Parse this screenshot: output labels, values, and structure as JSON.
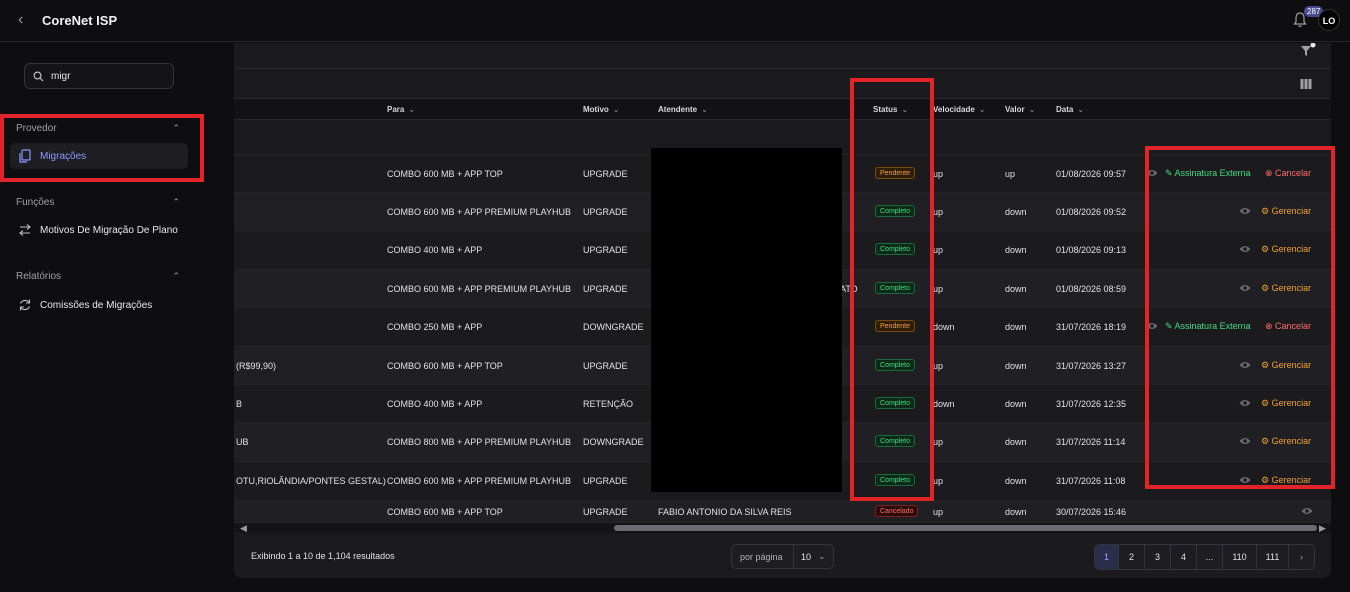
{
  "header": {
    "title": "CoreNet ISP",
    "notifications": "287",
    "user_initials": "LO"
  },
  "sidebar": {
    "search": {
      "value": "migr",
      "placeholder": ""
    },
    "sections": [
      {
        "label": "Provedor",
        "items": [
          {
            "label": "Migrações",
            "active": true,
            "icon": "copy-icon"
          }
        ]
      },
      {
        "label": "Funções",
        "items": [
          {
            "label": "Motivos De Migração De Plano",
            "icon": "arrows-swap-icon"
          }
        ]
      },
      {
        "label": "Relatórios",
        "items": [
          {
            "label": "Comissões de Migrações",
            "icon": "refresh-icon"
          }
        ]
      }
    ]
  },
  "table": {
    "columns": [
      "Para",
      "Motivo",
      "Atendente",
      "Status",
      "Velocidade",
      "Valor",
      "Data"
    ],
    "rows": [
      {
        "de": "",
        "para": "COMBO 600 MB + APP TOP",
        "motivo": "UPGRADE",
        "atendente": "",
        "status": "Pendente",
        "velocidade": "up",
        "valor": "up",
        "data": "01/08/2026 09:57",
        "actions": [
          "Assinatura Externa",
          "Cancelar"
        ]
      },
      {
        "de": "",
        "para": "COMBO 600 MB + APP PREMIUM PLAYHUB",
        "motivo": "UPGRADE",
        "atendente": "",
        "status": "Completo",
        "velocidade": "up",
        "valor": "down",
        "data": "01/08/2026 09:52",
        "actions": [
          "Gerenciar"
        ]
      },
      {
        "de": "",
        "para": "COMBO 400 MB + APP",
        "motivo": "UPGRADE",
        "atendente": "",
        "status": "Completo",
        "velocidade": "up",
        "valor": "down",
        "data": "01/08/2026 09:13",
        "actions": [
          "Gerenciar"
        ]
      },
      {
        "de": "",
        "para": "COMBO 600 MB + APP PREMIUM PLAYHUB",
        "motivo": "UPGRADE",
        "atendente": "ATO",
        "status": "Completo",
        "velocidade": "up",
        "valor": "down",
        "data": "01/08/2026 08:59",
        "actions": [
          "Gerenciar"
        ]
      },
      {
        "de": "",
        "para": "COMBO 250 MB + APP",
        "motivo": "DOWNGRADE",
        "atendente": "",
        "status": "Pendente",
        "velocidade": "down",
        "valor": "down",
        "data": "31/07/2026 18:19",
        "actions": [
          "Assinatura Externa",
          "Cancelar"
        ]
      },
      {
        "de": "(R$99,90)",
        "para": "COMBO 600 MB + APP TOP",
        "motivo": "UPGRADE",
        "atendente": "",
        "status": "Completo",
        "velocidade": "up",
        "valor": "down",
        "data": "31/07/2026 13:27",
        "actions": [
          "Gerenciar"
        ]
      },
      {
        "de": "B",
        "para": "COMBO 400 MB + APP",
        "motivo": "RETENÇÃO",
        "atendente": "",
        "status": "Completo",
        "velocidade": "down",
        "valor": "down",
        "data": "31/07/2026 12:35",
        "actions": [
          "Gerenciar"
        ]
      },
      {
        "de": "UB",
        "para": "COMBO 800 MB + APP PREMIUM PLAYHUB",
        "motivo": "DOWNGRADE",
        "atendente": "",
        "status": "Completo",
        "velocidade": "up",
        "valor": "down",
        "data": "31/07/2026 11:14",
        "actions": [
          "Gerenciar"
        ]
      },
      {
        "de": "OTU,RIOLÂNDIA/PONTES GESTAL)",
        "para": "COMBO 600 MB + APP PREMIUM PLAYHUB",
        "motivo": "UPGRADE",
        "atendente": "",
        "status": "Completo",
        "velocidade": "up",
        "valor": "down",
        "data": "31/07/2026 11:08",
        "actions": [
          "Gerenciar"
        ]
      },
      {
        "de": "",
        "para": "COMBO 600 MB + APP TOP",
        "motivo": "UPGRADE",
        "atendente": "FABIO ANTONIO DA SILVA REIS",
        "status": "Cancelado",
        "velocidade": "up",
        "valor": "down",
        "data": "30/07/2026 15:46",
        "actions": []
      }
    ]
  },
  "footer": {
    "summary": "Exibindo 1 a 10 de 1,104 resultados",
    "per_page_label": "por página",
    "per_page_value": "10",
    "pages": [
      "1",
      "2",
      "3",
      "4",
      "...",
      "110",
      "111"
    ],
    "current_page": "1"
  },
  "colors": {
    "accent": "#8f96ff",
    "pending": "#f0a030",
    "complete": "#3ddc84",
    "cancel": "#ff6b6b",
    "highlight": "#e0242a"
  }
}
